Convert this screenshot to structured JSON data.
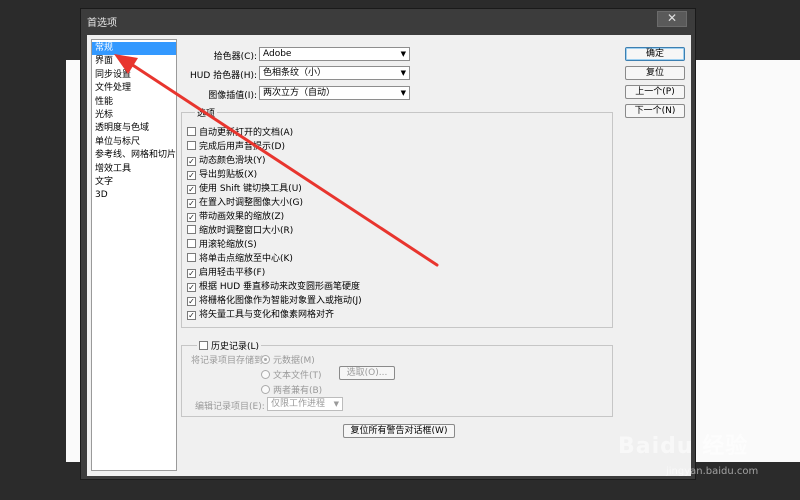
{
  "window": {
    "title": "首选项",
    "close_glyph": "✕"
  },
  "categories": [
    {
      "label": "常规",
      "selected": true
    },
    {
      "label": "界面",
      "selected": false
    },
    {
      "label": "同步设置",
      "selected": false
    },
    {
      "label": "文件处理",
      "selected": false
    },
    {
      "label": "性能",
      "selected": false
    },
    {
      "label": "光标",
      "selected": false
    },
    {
      "label": "透明度与色域",
      "selected": false
    },
    {
      "label": "单位与标尺",
      "selected": false
    },
    {
      "label": "参考线、网格和切片",
      "selected": false
    },
    {
      "label": "增效工具",
      "selected": false
    },
    {
      "label": "文字",
      "selected": false
    },
    {
      "label": "3D",
      "selected": false
    }
  ],
  "general": {
    "color_picker_label": "拾色器(C):",
    "color_picker_value": "Adobe",
    "hud_picker_label": "HUD 拾色器(H):",
    "hud_picker_value": "色相条纹（小）",
    "interpolation_label": "图像插值(I):",
    "interpolation_value": "两次立方（自动）"
  },
  "options": {
    "title": "选项",
    "items": [
      {
        "label": "自动更新打开的文档(A)",
        "checked": false
      },
      {
        "label": "完成后用声音提示(D)",
        "checked": false
      },
      {
        "label": "动态颜色滑块(Y)",
        "checked": true
      },
      {
        "label": "导出剪贴板(X)",
        "checked": true
      },
      {
        "label": "使用 Shift 键切换工具(U)",
        "checked": true
      },
      {
        "label": "在置入时调整图像大小(G)",
        "checked": true
      },
      {
        "label": "带动画效果的缩放(Z)",
        "checked": true
      },
      {
        "label": "缩放时调整窗口大小(R)",
        "checked": false
      },
      {
        "label": "用滚轮缩放(S)",
        "checked": false
      },
      {
        "label": "将单击点缩放至中心(K)",
        "checked": false
      },
      {
        "label": "启用轻击平移(F)",
        "checked": true
      },
      {
        "label": "根据 HUD 垂直移动来改变圆形画笔硬度",
        "checked": true
      },
      {
        "label": "将栅格化图像作为智能对象置入或拖动(J)",
        "checked": true
      },
      {
        "label": "将矢量工具与变化和像素网格对齐",
        "checked": true
      }
    ]
  },
  "history": {
    "title": "历史记录(L)",
    "checked": false,
    "save_to_label": "将记录项目存储到:",
    "radio_metadata": "元数据(M)",
    "radio_textfile": "文本文件(T)",
    "radio_both": "两者兼有(B)",
    "choose_button": "选取(O)...",
    "edit_log_label": "编辑记录项目(E):",
    "edit_log_value": "仅限工作进程"
  },
  "reset_warnings_button": "复位所有警告对话框(W)",
  "buttons": {
    "ok": "确定",
    "reset": "复位",
    "prev": "上一个(P)",
    "next": "下一个(N)"
  },
  "watermark": {
    "text": "Baidu 经验",
    "url_text": "jingyan.baidu.com"
  },
  "colors": {
    "selection": "#3399ff",
    "annotation_arrow": "#e8352e",
    "dialog_frame": "#3c3c3c"
  }
}
